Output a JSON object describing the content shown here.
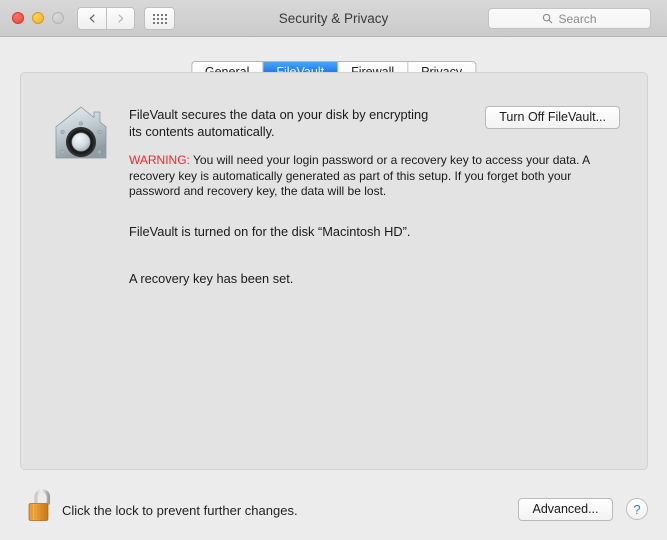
{
  "window": {
    "title": "Security & Privacy",
    "traffic_lights": [
      {
        "name": "close",
        "color": "#f2453a"
      },
      {
        "name": "minimize",
        "color": "#f5b323"
      },
      {
        "name": "zoom-disabled",
        "color": "#c6c6c6"
      }
    ],
    "nav": {
      "back_icon": "chevron-left-icon",
      "forward_icon": "chevron-right-icon",
      "show_all_icon": "grid-dots-icon"
    },
    "search": {
      "icon": "search-icon",
      "placeholder": "Search",
      "value": ""
    }
  },
  "tabs": [
    {
      "label": "General",
      "selected": false
    },
    {
      "label": "FileVault",
      "selected": true
    },
    {
      "label": "Firewall",
      "selected": false
    },
    {
      "label": "Privacy",
      "selected": false
    }
  ],
  "filevault": {
    "icon": "filevault-house-safe-icon",
    "description": "FileVault secures the data on your disk by encrypting its contents automatically.",
    "turn_off_button": "Turn Off FileVault...",
    "warning_label": "WARNING:",
    "warning_text": " You will need your login password or a recovery key to access your data. A recovery key is automatically generated as part of this setup. If you forget both your password and recovery key, the data will be lost.",
    "status_disk": "FileVault is turned on for the disk “Macintosh HD”.",
    "status_recovery_key": "A recovery key has been set."
  },
  "footer": {
    "lock_icon": "open-padlock-icon",
    "lock_caption": "Click the lock to prevent further changes.",
    "advanced_button": "Advanced...",
    "help_button": "?"
  },
  "colors": {
    "accent_blue": "#1878ef",
    "warning_red": "#ef2b2b",
    "titlebar": "#d0d0d0",
    "body_bg": "#ececec",
    "panel_bg": "#e3e3e3",
    "help_glyph": "#2f7ee0"
  }
}
